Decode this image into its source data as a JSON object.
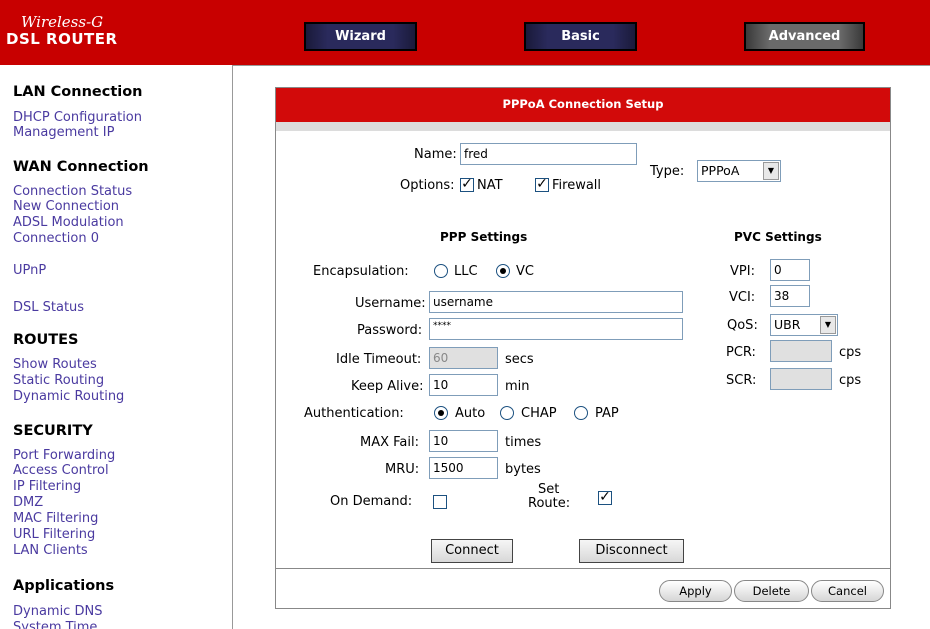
{
  "logo": {
    "line1": "Wireless-G",
    "line2": "DSL ROUTER"
  },
  "nav": {
    "wizard": "Wizard",
    "basic": "Basic",
    "advanced": "Advanced"
  },
  "sidebar": {
    "lan": {
      "heading": "LAN Connection",
      "items": [
        "DHCP Configuration",
        "Management IP"
      ]
    },
    "wan": {
      "heading": "WAN Connection",
      "items": [
        "Connection Status",
        "New Connection",
        "ADSL Modulation",
        "Connection 0"
      ]
    },
    "upnp": "UPnP",
    "dsl_status": "DSL Status",
    "routes": {
      "heading": "ROUTES",
      "items": [
        "Show Routes",
        "Static Routing",
        "Dynamic Routing"
      ]
    },
    "security": {
      "heading": "SECURITY",
      "items": [
        "Port Forwarding",
        "Access Control",
        "IP Filtering",
        "DMZ",
        "MAC Filtering",
        "URL Filtering",
        "LAN Clients"
      ]
    },
    "applications": {
      "heading": "Applications",
      "items": [
        "Dynamic DNS",
        "System Time"
      ]
    }
  },
  "panel": {
    "title": "PPPoA Connection Setup",
    "name_label": "Name:",
    "name_value": "fred",
    "options_label": "Options:",
    "nat_label": "NAT",
    "nat_checked": true,
    "firewall_label": "Firewall",
    "firewall_checked": true,
    "type_label": "Type:",
    "type_value": "PPPoA",
    "ppp_heading": "PPP Settings",
    "pvc_heading": "PVC Settings",
    "encapsulation_label": "Encapsulation:",
    "encap_llc": "LLC",
    "encap_vc": "VC",
    "encap_selected": "VC",
    "username_label": "Username:",
    "username_value": "username",
    "password_label": "Password:",
    "password_value": "****",
    "idle_timeout_label": "Idle Timeout:",
    "idle_timeout_value": "60",
    "idle_timeout_unit": "secs",
    "keep_alive_label": "Keep Alive:",
    "keep_alive_value": "10",
    "keep_alive_unit": "min",
    "auth_label": "Authentication:",
    "auth_auto": "Auto",
    "auth_chap": "CHAP",
    "auth_pap": "PAP",
    "auth_selected": "Auto",
    "max_fail_label": "MAX Fail:",
    "max_fail_value": "10",
    "max_fail_unit": "times",
    "mru_label": "MRU:",
    "mru_value": "1500",
    "mru_unit": "bytes",
    "on_demand_label": "On Demand:",
    "on_demand_checked": false,
    "set_route_label_1": "Set",
    "set_route_label_2": "Route:",
    "set_route_checked": true,
    "vpi_label": "VPI:",
    "vpi_value": "0",
    "vci_label": "VCI:",
    "vci_value": "38",
    "qos_label": "QoS:",
    "qos_value": "UBR",
    "pcr_label": "PCR:",
    "pcr_value": "",
    "pcr_unit": "cps",
    "scr_label": "SCR:",
    "scr_value": "",
    "scr_unit": "cps",
    "connect_label": "Connect",
    "disconnect_label": "Disconnect",
    "apply_label": "Apply",
    "delete_label": "Delete",
    "cancel_label": "Cancel"
  }
}
